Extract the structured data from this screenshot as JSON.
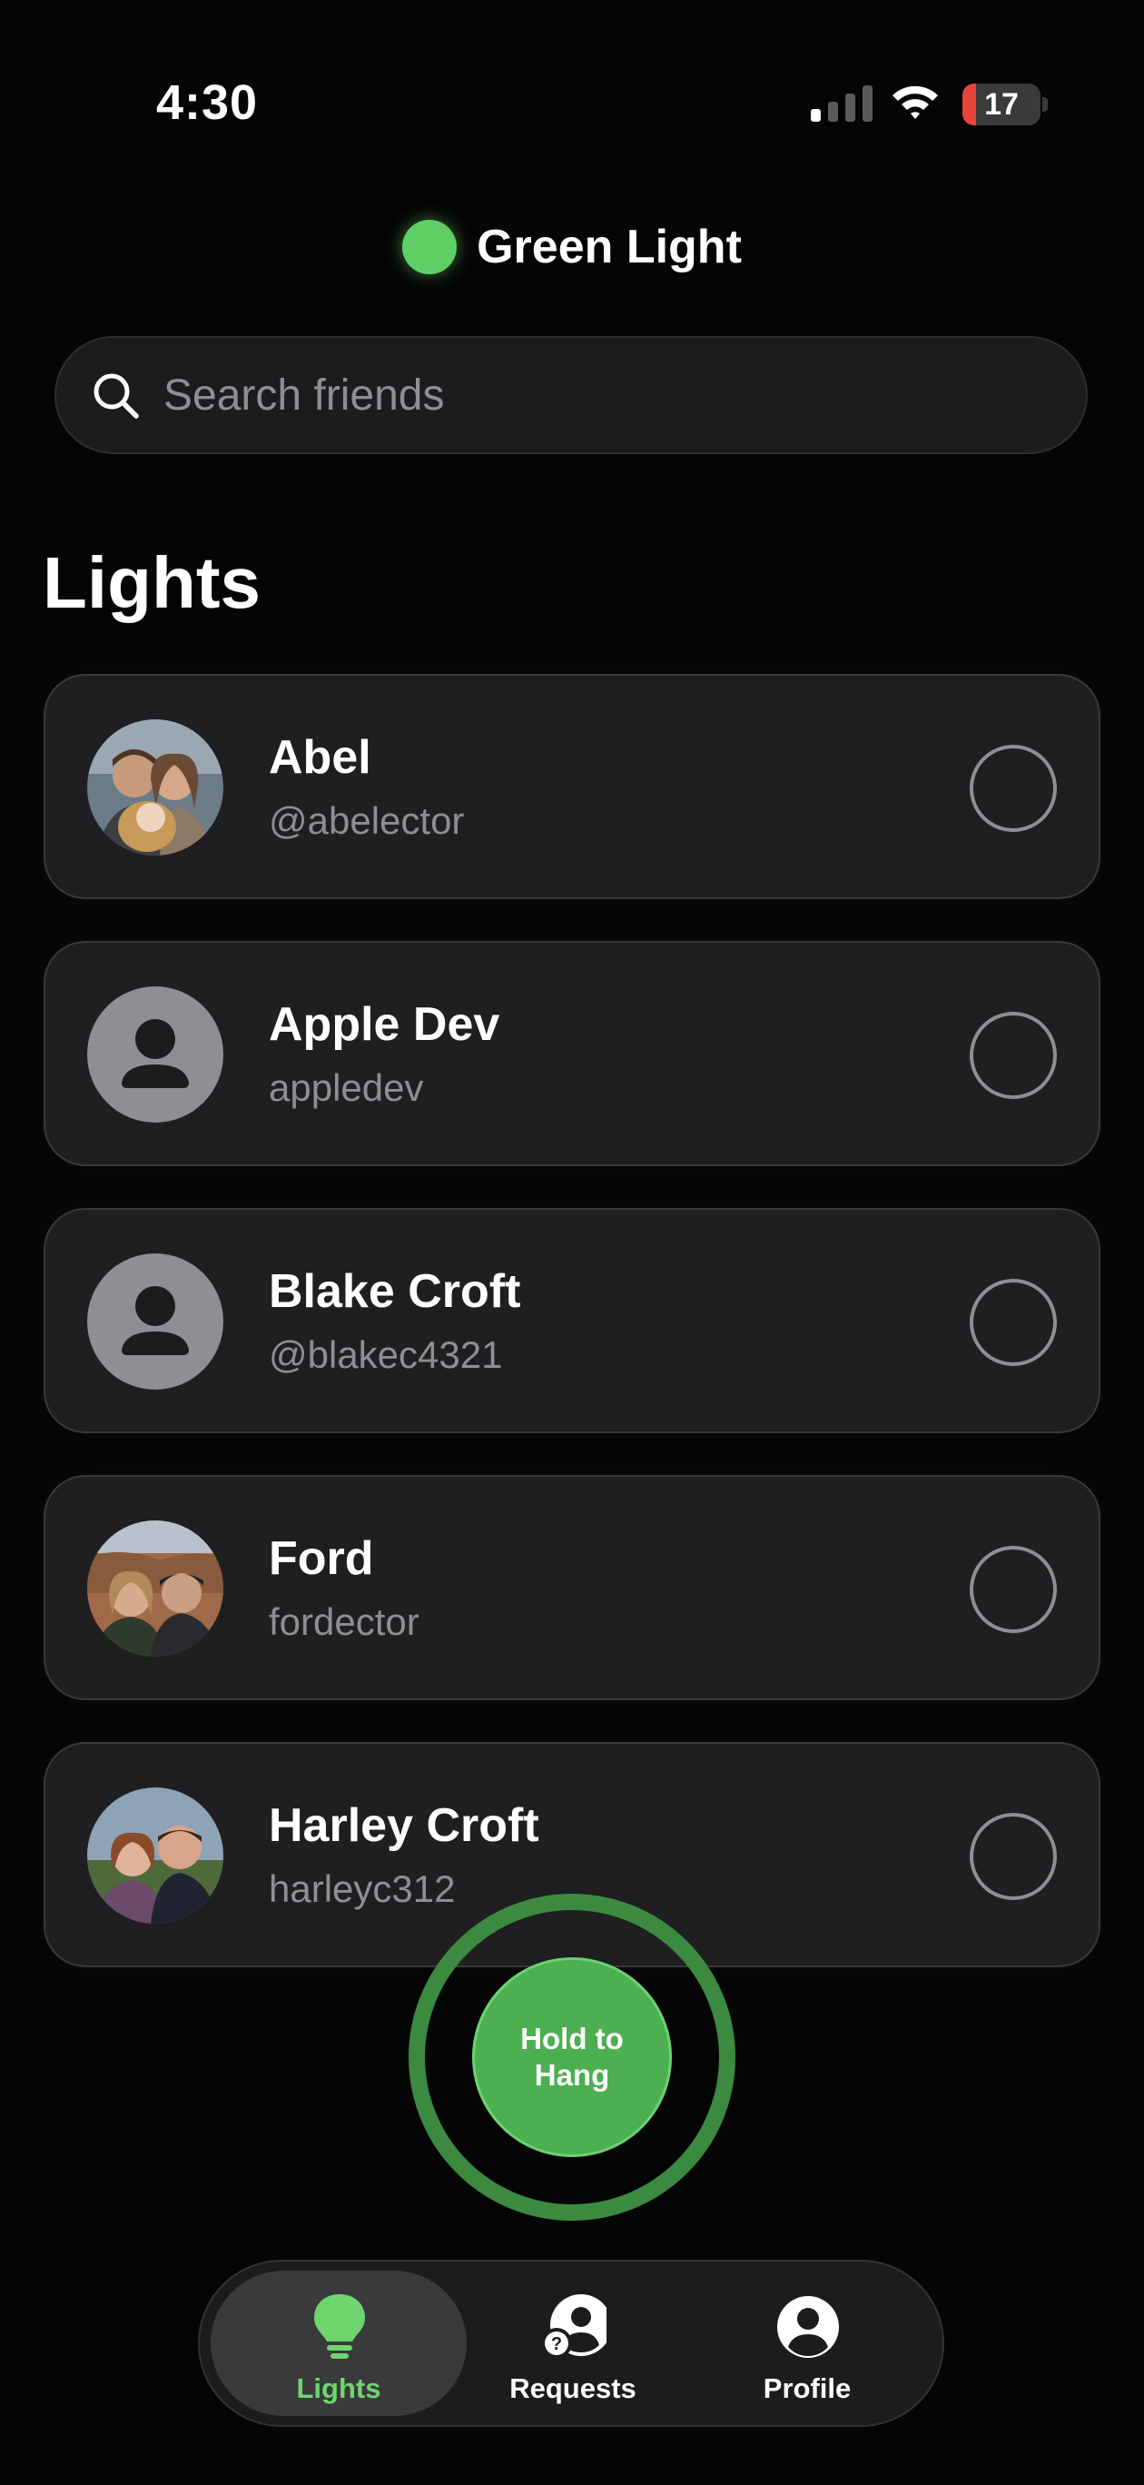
{
  "status_bar": {
    "time": "4:30",
    "battery_percent": 17,
    "battery_label": "17",
    "battery_color": "#e5453b",
    "signal_bars": 4,
    "signal_bars_active": 1,
    "wifi_icon": "wifi-icon"
  },
  "header": {
    "title": "Green Light",
    "status_dot_color": "#5fcf65"
  },
  "search": {
    "placeholder": "Search friends",
    "value": "",
    "icon": "search-icon"
  },
  "section": {
    "title": "Lights"
  },
  "friends": [
    {
      "name": "Abel",
      "handle": "@abelector",
      "avatar": "photo",
      "selected": false
    },
    {
      "name": "Apple Dev",
      "handle": "appledev",
      "avatar": "placeholder",
      "selected": false
    },
    {
      "name": "Blake Croft",
      "handle": "@blakec4321",
      "avatar": "placeholder",
      "selected": false
    },
    {
      "name": "Ford",
      "handle": "fordector",
      "avatar": "photo",
      "selected": false
    },
    {
      "name": "Harley Croft",
      "handle": "harleyc312",
      "avatar": "photo",
      "selected": false
    }
  ],
  "hang_button": {
    "label": "Hold to Hang",
    "color": "#4caf50"
  },
  "tabs": [
    {
      "label": "Lights",
      "icon": "lightbulb-icon",
      "active": true,
      "active_color": "#6fd66f"
    },
    {
      "label": "Requests",
      "icon": "friend-request-icon",
      "active": false
    },
    {
      "label": "Profile",
      "icon": "profile-icon",
      "active": false
    }
  ]
}
